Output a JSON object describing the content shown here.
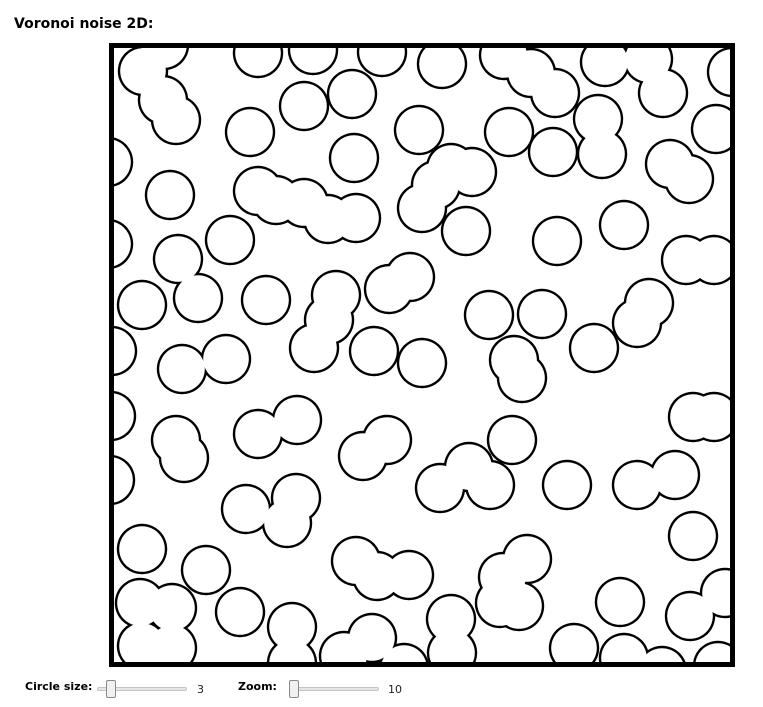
{
  "title": "Voronoi noise 2D:",
  "controls": {
    "circle_size": {
      "label": "Circle size:",
      "value": "3",
      "fraction": 0.15
    },
    "zoom": {
      "label": "Zoom:",
      "value": "10",
      "fraction": 0.05
    }
  },
  "colors": {
    "background": "#ffffff",
    "stroke": "#000000",
    "fill": "#ffffff"
  }
}
